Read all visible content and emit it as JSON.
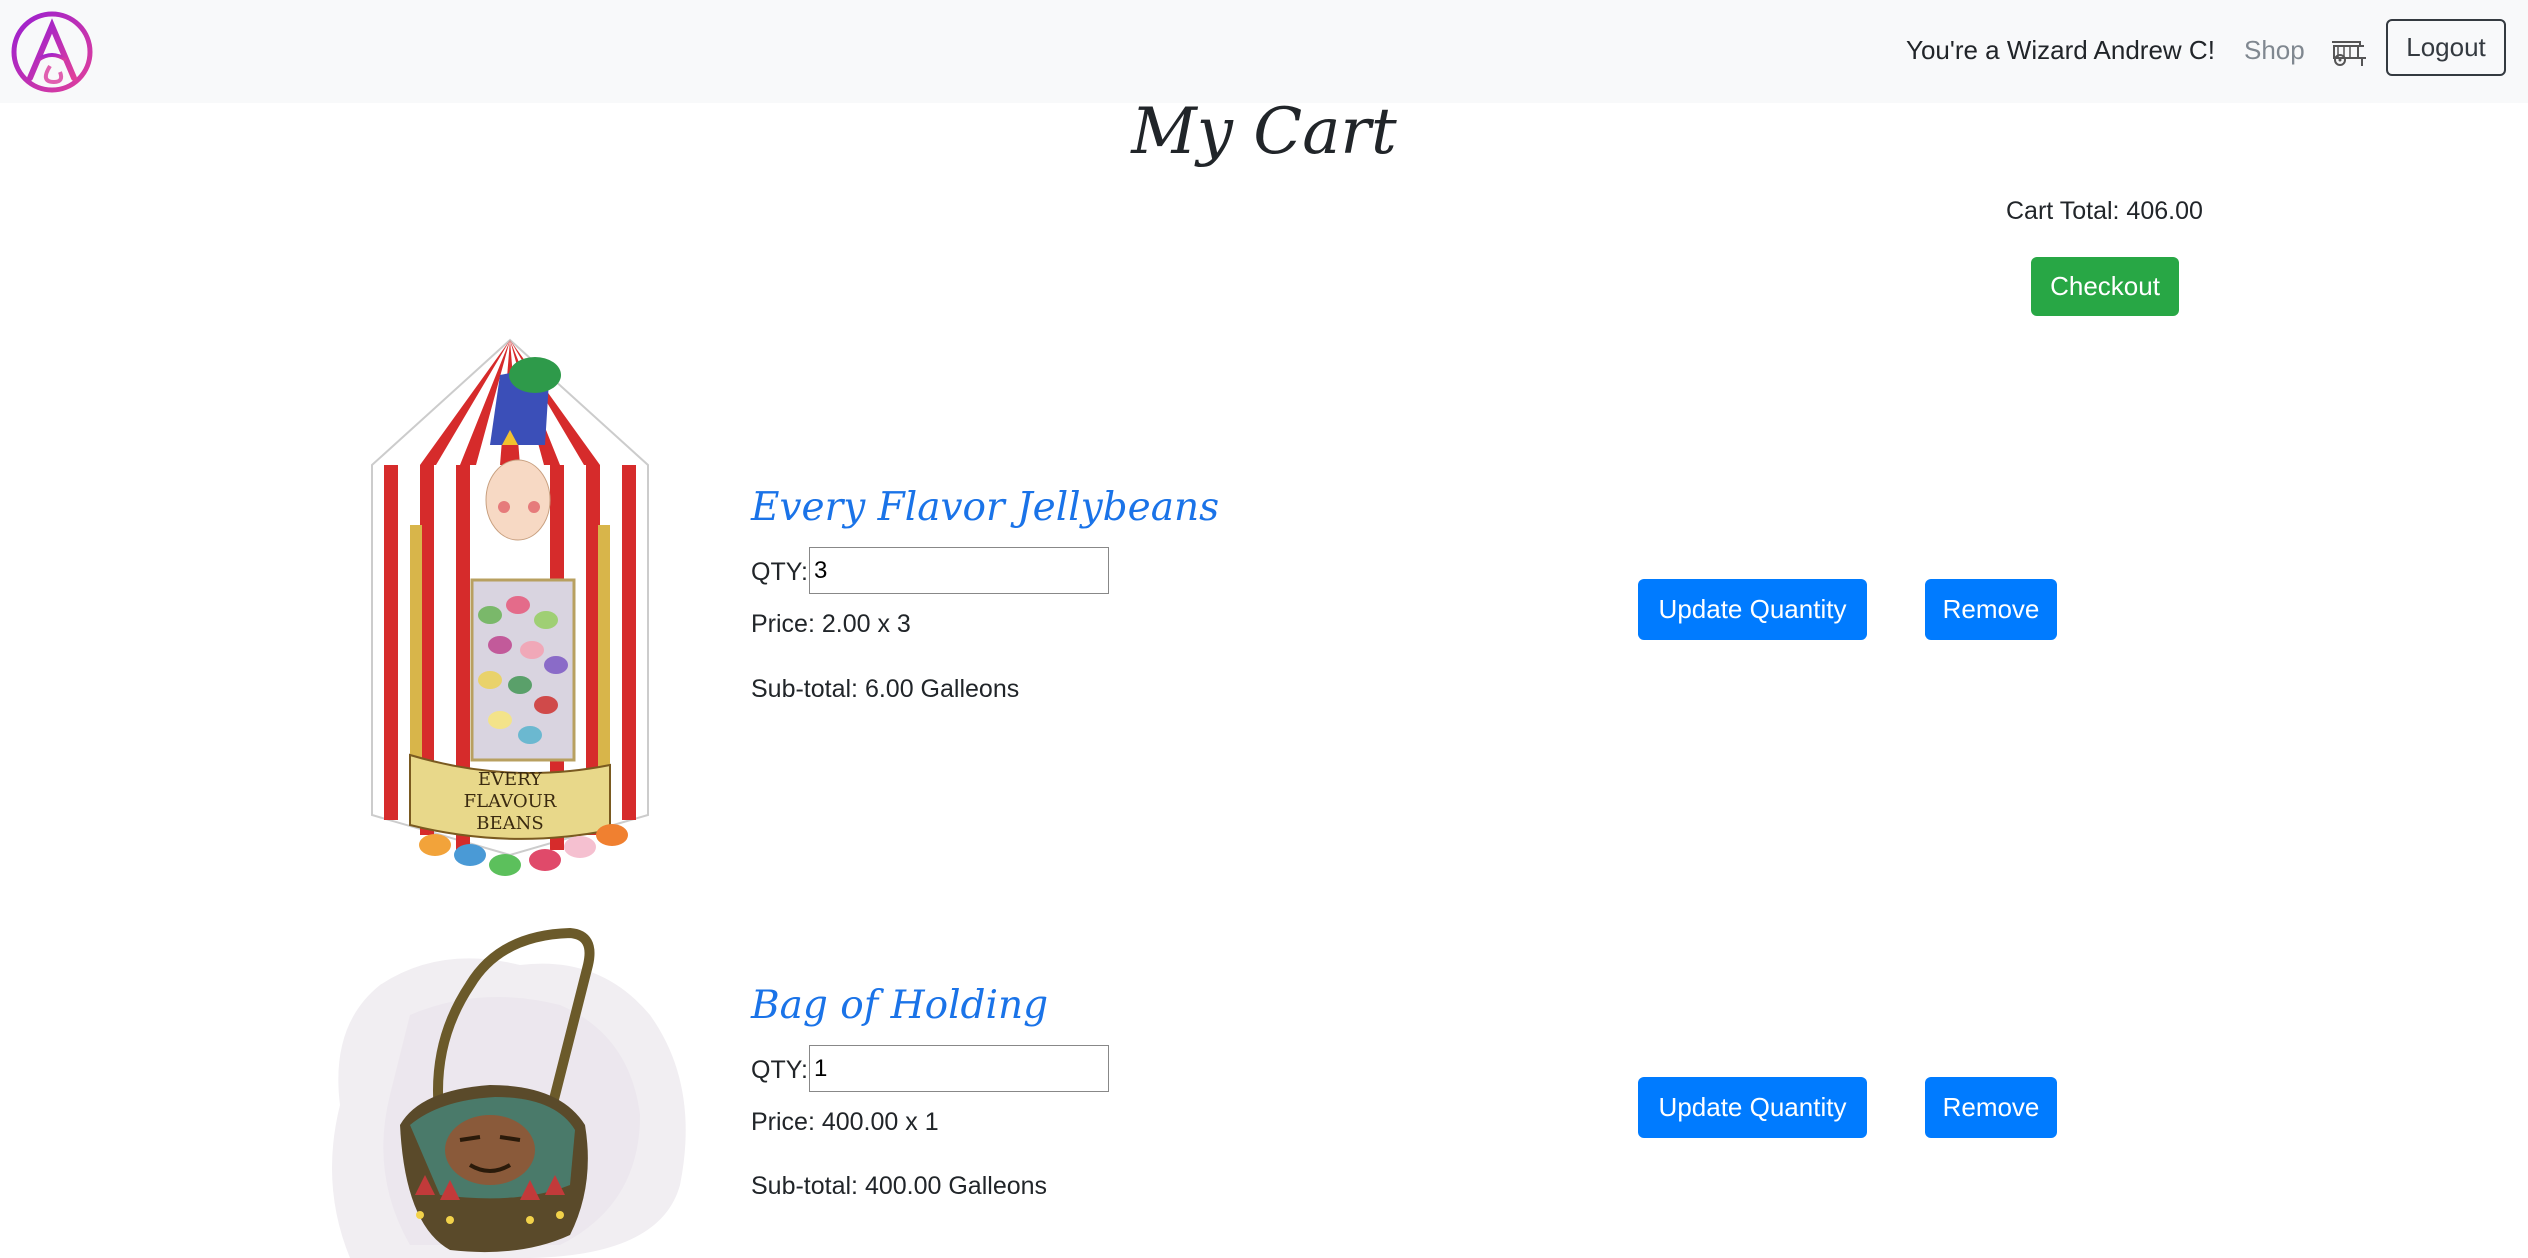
{
  "nav": {
    "greeting": "You're a Wizard Andrew C!",
    "shop_label": "Shop",
    "logout_label": "Logout",
    "logo_letter": "A"
  },
  "page": {
    "title": "My Cart",
    "cart_total": "Cart Total: 406.00",
    "checkout_label": "Checkout"
  },
  "items": [
    {
      "name": "Every Flavor Jellybeans",
      "qty_label": "QTY:",
      "qty_value": "3",
      "price": "Price: 2.00 x 3",
      "subtotal": "Sub-total: 6.00 Galleons",
      "update_label": "Update Quantity",
      "remove_label": "Remove",
      "box_text": [
        "EVERY",
        "FLAVOUR",
        "BEANS"
      ]
    },
    {
      "name": "Bag of Holding",
      "qty_label": "QTY:",
      "qty_value": "1",
      "price": "Price: 400.00 x 1",
      "subtotal": "Sub-total: 400.00 Galleons",
      "update_label": "Update Quantity",
      "remove_label": "Remove"
    }
  ],
  "colors": {
    "navbar_bg": "#f8f9fa",
    "link_blue": "#1a73e8",
    "primary_button": "#007bff",
    "checkout_green": "#28a745",
    "logo_purple": "#a020c0"
  }
}
